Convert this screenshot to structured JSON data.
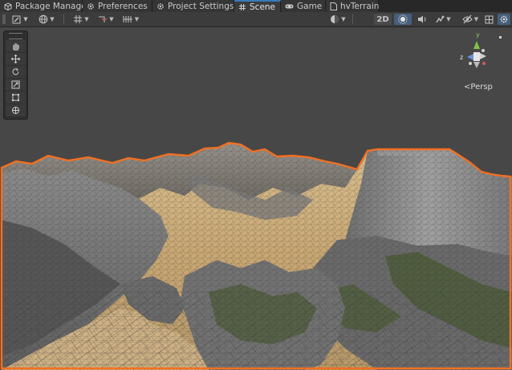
{
  "tabs": [
    {
      "label": "Package Manager",
      "icon": "package-icon",
      "active": false
    },
    {
      "label": "Preferences",
      "icon": "gear-icon",
      "active": false
    },
    {
      "label": "Project Settings",
      "icon": "gear-icon",
      "active": false
    },
    {
      "label": "Scene",
      "icon": "grid-icon",
      "active": true
    },
    {
      "label": "Game",
      "icon": "gamepad-icon",
      "active": false
    },
    {
      "label": "hvTerrain",
      "icon": "document-icon",
      "active": false
    }
  ],
  "toolbar": {
    "mode_2d_label": "2D",
    "left_tools": [
      "draw-mode-icon",
      "globe-icon",
      "grid-snap-icon",
      "pivot-icon",
      "increment-snap-icon"
    ],
    "right_tools": [
      "shading-sphere-icon",
      "lighting-icon",
      "audio-icon",
      "effects-icon",
      "visibility-icon",
      "gizmo-icon",
      "camera-icon"
    ]
  },
  "scene_tools": [
    "hand-icon",
    "move-icon",
    "rotate-icon",
    "scale-icon",
    "rect-icon",
    "transform-icon"
  ],
  "gizmo": {
    "axis_y": "y",
    "axis_z": "z",
    "projection_label": "Persp"
  },
  "colors": {
    "active_tab_accent": "#3a79bb",
    "selection_outline": "#f26f22",
    "toolbar_active": "#46607c",
    "sky": "#474747"
  }
}
